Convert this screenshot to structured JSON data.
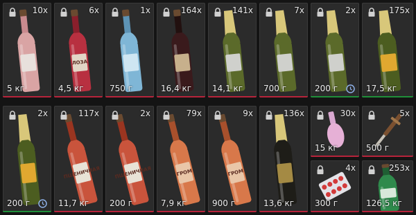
{
  "inventory": {
    "items": [
      {
        "kind": "wine-white",
        "count": "10x",
        "weight": "5 кг",
        "label": "",
        "underline": "#b8233b"
      },
      {
        "kind": "wine-red",
        "count": "6x",
        "weight": "4,5 кг",
        "label": "ЛОЗА",
        "underline": "#b8233b"
      },
      {
        "kind": "wine-blue",
        "count": "1x",
        "weight": "750 г",
        "label": "",
        "underline": "#b8233b"
      },
      {
        "kind": "wine-dark",
        "count": "164x",
        "weight": "16,4 кг",
        "label": "",
        "underline": "#b8233b"
      },
      {
        "kind": "champagne-silver",
        "count": "141x",
        "weight": "14,1 кг",
        "label": "",
        "underline": "#b8233b"
      },
      {
        "kind": "champagne-silver",
        "count": "7x",
        "weight": "700 г",
        "label": "",
        "underline": "#b8233b"
      },
      {
        "kind": "champagne-silver",
        "count": "2x",
        "weight": "200 г",
        "label": "",
        "clock": true,
        "underline": "#1f8f3a"
      },
      {
        "kind": "champagne-yellow",
        "count": "175x",
        "weight": "17,5 кг",
        "label": "",
        "underline": "#1f8f3a"
      },
      {
        "kind": "champagne-yellow",
        "count": "2x",
        "weight": "200 г",
        "label": "",
        "clock": true,
        "underline": "#1f8f3a"
      },
      {
        "kind": "vodka-red",
        "count": "117x",
        "weight": "11,7 кг",
        "label": "ПШЕНИЧНАЯ ВОДКА",
        "underline": "#b8233b"
      },
      {
        "kind": "vodka-red",
        "count": "2x",
        "weight": "200 г",
        "label": "ПШЕНИЧНАЯ ВОДКА",
        "underline": "#b8233b"
      },
      {
        "kind": "vodka-orange",
        "count": "79x",
        "weight": "7,9 кг",
        "label": "ГРОМ",
        "underline": "#b8233b"
      },
      {
        "kind": "vodka-orange",
        "count": "9x",
        "weight": "900 г",
        "label": "ГРОМ",
        "underline": "#b8233b"
      },
      {
        "kind": "champagne-dark",
        "count": "136x",
        "weight": "13,6 кг",
        "label": "",
        "underline": "#b8233b"
      },
      {
        "kind": "flask",
        "count": "30x",
        "weight": "15 кг",
        "label": "",
        "underline": "#b8233b"
      },
      {
        "kind": "knife",
        "count": "5x",
        "weight": "500 г",
        "label": "",
        "underline": "#b8233b"
      },
      {
        "kind": "pills",
        "count": "4x",
        "weight": "300 г",
        "label": "",
        "underline": "#b8233b"
      },
      {
        "kind": "bottle-green",
        "count": "253x",
        "weight": "126,5 кг",
        "label": "",
        "underline": "#b8233b"
      }
    ]
  },
  "colors": {
    "bg": "#2b2b2b",
    "text": "#ededed",
    "red": "#b8233b",
    "green": "#1f8f3a"
  }
}
